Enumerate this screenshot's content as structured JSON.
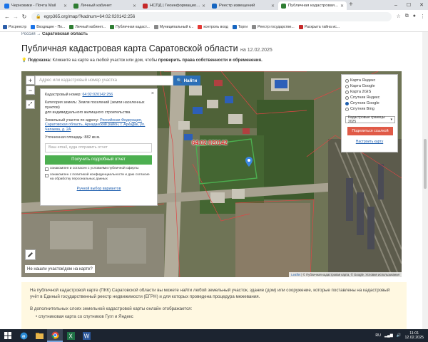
{
  "browser": {
    "tabs": [
      {
        "title": "Черновики - Почта Mail",
        "color": "#1a73e8",
        "active": false
      },
      {
        "title": "Личный кабинет",
        "color": "#2e7d32",
        "active": false
      },
      {
        "title": "НСПД | Геоинформационн",
        "color": "#c62828",
        "active": false
      },
      {
        "title": "Реестр извещений",
        "color": "#1565c0",
        "active": false
      },
      {
        "title": "Публичная кадастровая карт",
        "color": "#2e7d32",
        "active": true
      }
    ],
    "new_tab_label": "+",
    "url": "egrp365.org/map/?kadnum=64:02:020142:256",
    "bookmarks": [
      {
        "label": "Росреестр",
        "color": "#2b5da8"
      },
      {
        "label": "Входящие - По...",
        "color": "#1a73e8"
      },
      {
        "label": "Личный кабинет...",
        "color": "#2e7d32"
      },
      {
        "label": "Публичная кадаст...",
        "color": "#2e7d32"
      },
      {
        "label": "Муниципальный к...",
        "color": "#888888"
      },
      {
        "label": "контроль вход",
        "color": "#e53935"
      },
      {
        "label": "Торги",
        "color": "#1565c0"
      },
      {
        "label": "Реестр государстве...",
        "color": "#888888"
      },
      {
        "label": "Раскрыта тайна ис...",
        "color": "#c62828"
      }
    ]
  },
  "page": {
    "breadcrumb_prefix": "Россия →",
    "breadcrumb_current": "Саратовская область",
    "title": "Публичная кадастровая карта Саратовской области",
    "title_date": "на 12.02.2025",
    "hint_label": "Подсказка:",
    "hint_text": "Кликните на карте на любой участок или дом, чтобы",
    "hint_bold": "проверить права собственности и обременения."
  },
  "map": {
    "search_placeholder": "Адрес или кадастровый номер участка",
    "search_button": "Найти",
    "zoom_in": "+",
    "zoom_out": "−",
    "parcel_label": "64:02:020142",
    "not_found": "Не нашли участок/дом на карте?",
    "attribution_leaflet": "Leaflet",
    "attribution_text": "© Публичная кадастровая карта, © Google. Условия использования",
    "info": {
      "kadnum_label": "Кадастровый номер:",
      "kadnum_value": "64:02:020142:256",
      "category_label": "Категория земель:",
      "category_value": "Земли поселений (земли населенных пунктов)",
      "use_value": "для индивидуального жилищного строительства",
      "address_label": "Земельный участок по адресу:",
      "address_value": "Российская Федерация, Саратовская область, Аркадакский район, г. Аркадак, ул. Чапаева, д. 2А",
      "area_label": "Уточненная площадь:",
      "area_value": "882 кв.м.",
      "email_placeholder": "Ваш email, куда отправить отчет",
      "get_report_button": "Получить подробный отчет",
      "consent_1": "ознакомлен и согласен с условиями публичной оферты",
      "consent_2": "ознакомлен с политикой конфиденциальности и даю согласие на обработку персональных данных",
      "manual_link": "Ручной выбор вариантов",
      "close": "×"
    },
    "layers": {
      "options": [
        {
          "label": "Карта Яндекс",
          "checked": false
        },
        {
          "label": "Карта Google",
          "checked": false
        },
        {
          "label": "Карта 2GIS",
          "checked": false
        },
        {
          "label": "Спутник Яндекс",
          "checked": false
        },
        {
          "label": "Спутник Google",
          "checked": true
        },
        {
          "label": "Спутник Bing",
          "checked": false
        }
      ],
      "boundaries_select": "Кадастровые границы 2025",
      "share_button": "Поделиться ссылкой",
      "report_error": "Настроить карту"
    }
  },
  "description": {
    "paragraph_1": "На публичной кадастровой карте (ПКК) Саратовской области вы можете найти любой земельный участок, здание (дом) или сооружение, которые поставлены на кадастровый учёт в Единый государственный реестр недвижимости (ЕГРН) и для которых проведена процедура межевания.",
    "paragraph_2": "В дополнительных слоях земельной кадастровой карты онлайн отображается:",
    "list_item_1": "• спутниковая карта со спутников Гугл и Яндекс"
  },
  "taskbar": {
    "lang": "RU",
    "time": "11:01",
    "date": "12.02.2025"
  }
}
